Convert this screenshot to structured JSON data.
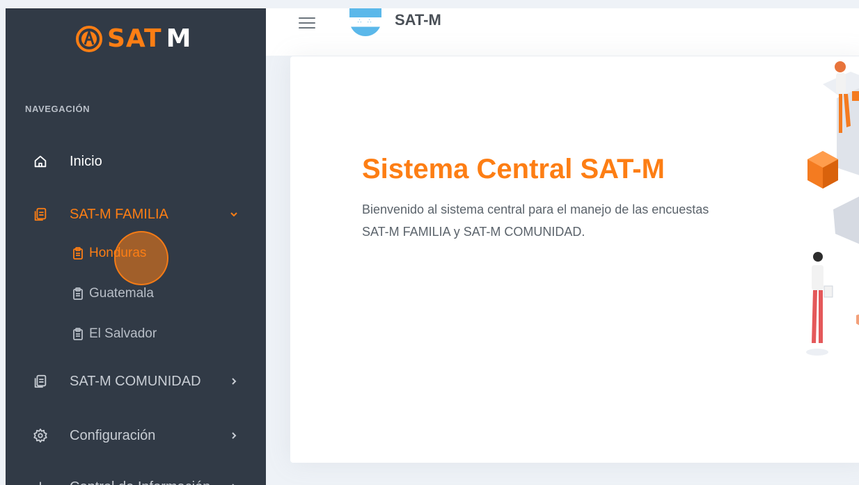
{
  "brand": {
    "logo_text": "SAT",
    "logo_suffix": "M",
    "accent_color": "#fd7e14",
    "sidebar_bg": "#313a46"
  },
  "sidebar": {
    "section_title": "NAVEGACIÓN",
    "items": [
      {
        "label": "Inicio",
        "icon": "home-icon"
      },
      {
        "label": "SAT-M FAMILIA",
        "icon": "documents-icon",
        "chevron": "chevron-down-icon"
      },
      {
        "label": "SAT-M COMUNIDAD",
        "icon": "documents-icon",
        "chevron": "chevron-right-icon"
      },
      {
        "label": "Configuración",
        "icon": "gear-icon",
        "chevron": "chevron-right-icon"
      },
      {
        "label": "Control de Información",
        "icon": "chart-icon",
        "chevron": "chevron-right-icon"
      }
    ],
    "familia_submenu": [
      {
        "label": "Honduras",
        "icon": "clipboard-icon"
      },
      {
        "label": "Guatemala",
        "icon": "clipboard-icon"
      },
      {
        "label": "El Salvador",
        "icon": "clipboard-icon"
      }
    ]
  },
  "topbar": {
    "title": "SAT-M",
    "flag_icon": "honduras-flag-icon",
    "menu_icon": "hamburger-menu-icon",
    "flag_dots": "∴ ∴"
  },
  "main": {
    "hero_title": "Sistema Central SAT-M",
    "hero_text": "Bienvenido al sistema central para el manejo de las encuestas SAT-M FAMILIA y SAT-M COMUNIDAD."
  }
}
